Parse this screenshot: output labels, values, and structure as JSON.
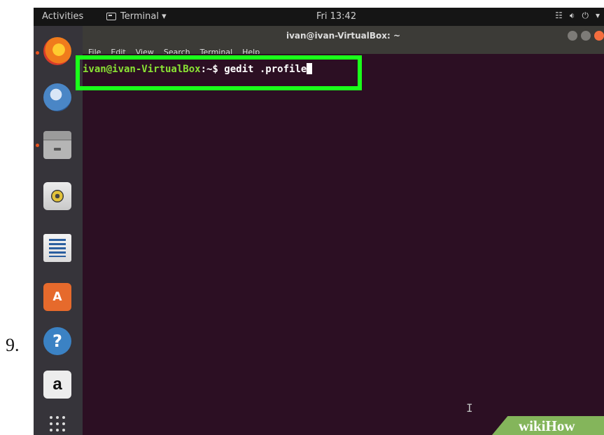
{
  "step_number": "9.",
  "topbar": {
    "activities": "Activities",
    "app_menu": "Terminal ▾",
    "clock": "Fri 13:42",
    "network_icon": "network-icon",
    "volume_icon": "volume-icon",
    "power_icon": "power-icon",
    "system_menu_arrow": "▾"
  },
  "dock": {
    "items": [
      {
        "name": "firefox",
        "icon": "firefox-icon"
      },
      {
        "name": "thunderbird",
        "icon": "thunderbird-icon"
      },
      {
        "name": "files",
        "icon": "files-icon"
      },
      {
        "name": "rhythmbox",
        "icon": "rhythmbox-icon"
      },
      {
        "name": "libreoffice-writer",
        "icon": "writer-icon"
      },
      {
        "name": "ubuntu-software",
        "icon": "software-icon",
        "glyph": "A"
      },
      {
        "name": "help",
        "icon": "help-icon",
        "glyph": "?"
      },
      {
        "name": "amazon",
        "icon": "amazon-icon",
        "glyph": "a"
      },
      {
        "name": "show-applications",
        "icon": "apps-grid-icon"
      }
    ]
  },
  "window": {
    "title": "ivan@ivan-VirtualBox: ~",
    "menu": [
      "File",
      "Edit",
      "View",
      "Search",
      "Terminal",
      "Help"
    ]
  },
  "terminal": {
    "prompt_user": "ivan@ivan-VirtualBox",
    "prompt_sep": ":~$ ",
    "command": "gedit .profile"
  },
  "watermark": "wikiHow",
  "colors": {
    "terminal_bg": "#2c0f23",
    "highlight": "#1aff1a",
    "prompt_green": "#8ae234",
    "accent_orange": "#e95420"
  }
}
